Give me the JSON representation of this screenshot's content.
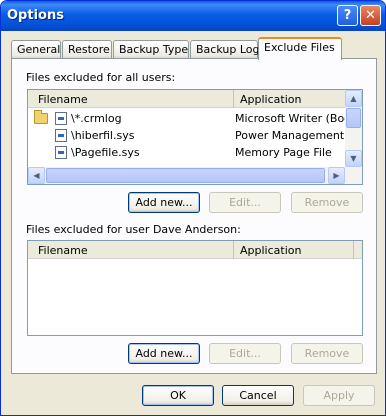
{
  "window": {
    "title": "Options"
  },
  "titlebar": {
    "help_glyph": "?",
    "close_glyph": "✕"
  },
  "tabs": [
    {
      "label": "General"
    },
    {
      "label": "Restore"
    },
    {
      "label": "Backup Type"
    },
    {
      "label": "Backup Log"
    },
    {
      "label": "Exclude Files"
    }
  ],
  "all_users": {
    "label": "Files excluded for all users:",
    "columns": [
      "Filename",
      "Application"
    ],
    "rows": [
      {
        "filename": "\\*.crmlog",
        "application": "Microsoft Writer (Boota..."
      },
      {
        "filename": "\\hiberfil.sys",
        "application": "Power Management"
      },
      {
        "filename": "\\Pagefile.sys",
        "application": "Memory Page File"
      }
    ],
    "buttons": {
      "add": "Add new...",
      "edit": "Edit...",
      "remove": "Remove"
    }
  },
  "user": {
    "label": "Files excluded for user Dave Anderson:",
    "columns": [
      "Filename",
      "Application"
    ],
    "buttons": {
      "add": "Add new...",
      "edit": "Edit...",
      "remove": "Remove"
    }
  },
  "footer": {
    "ok": "OK",
    "cancel": "Cancel",
    "apply": "Apply"
  }
}
